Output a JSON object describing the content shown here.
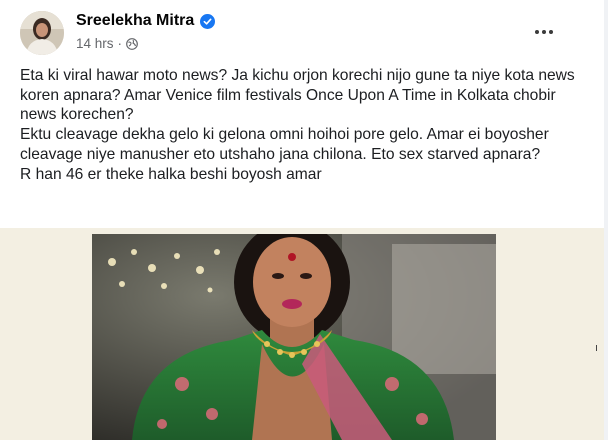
{
  "post": {
    "author": "Sreelekha Mitra",
    "time": "14 hrs",
    "separator": "·",
    "paragraphs": [
      "Eta ki viral hawar moto news? Ja kichu orjon korechi nijo gune ta niye kota news koren apnara? Amar Venice film festivals Once Upon A Time in Kolkata chobir news korechen?",
      "Ektu cleavage dekha gelo ki gelona omni hoihoi pore gelo. Amar ei boyosher cleavage niye manusher eto utshaho jana chilona. Eto sex starved apnara?",
      "R han 46 er theke halka beshi boyosh amar"
    ]
  },
  "icons": {
    "verified": "verified-badge-icon",
    "audience": "globe-icon",
    "more": "more-options-icon"
  },
  "colors": {
    "brand": "#1877f2",
    "text": "#1c1e21",
    "meta": "#65676b"
  }
}
